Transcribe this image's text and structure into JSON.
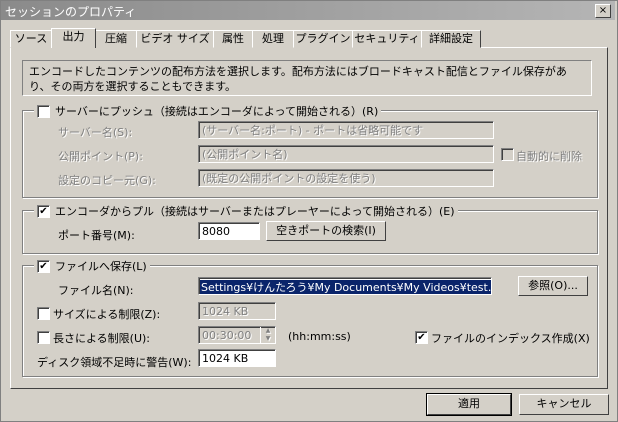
{
  "window": {
    "title": "セッションのプロパティ",
    "close": "×"
  },
  "tabs": [
    "ソース",
    "出力",
    "圧縮",
    "ビデオ サイズ",
    "属性",
    "処理",
    "プラグイン",
    "セキュリティ",
    "詳細設定"
  ],
  "description": "エンコードしたコンテンツの配布方法を選択します。配布方法にはブロードキャスト配信とファイル保存があり、その両方を選択することもできます。",
  "push": {
    "label": "サーバーにプッシュ（接続はエンコーダによって開始される）(R)",
    "checked": false,
    "server_name_label": "サーバー名(S):",
    "server_name_value": "(サーバー名:ポート) - ポートは省略可能です",
    "publish_point_label": "公開ポイント(P):",
    "publish_point_value": "(公開ポイント名)",
    "auto_delete_label": "自動的に削除",
    "copy_from_label": "設定のコピー元(G):",
    "copy_from_value": "(既定の公開ポイントの設定を使う)"
  },
  "pull": {
    "label": "エンコーダからプル（接続はサーバーまたはプレーヤーによって開始される）(E)",
    "checked": true,
    "port_label": "ポート番号(M):",
    "port_value": "8080",
    "find_port_button": "空きポートの検索(I)"
  },
  "file": {
    "label": "ファイルへ保存(L)",
    "checked": true,
    "filename_label": "ファイル名(N):",
    "filename_value": "Settings¥けんたろう¥My Documents¥My Videos¥test.wmv",
    "browse_button": "参照(O)...",
    "size_limit_label": "サイズによる制限(Z):",
    "size_limit_value": "1024 KB",
    "length_limit_label": "長さによる制限(U):",
    "length_limit_value": "00:30:00",
    "length_format": "(hh:mm:ss)",
    "index_label": "ファイルのインデックス作成(X)",
    "index_checked": true,
    "disk_warning_label": "ディスク領域不足時に警告(W):",
    "disk_warning_value": "1024 KB"
  },
  "footer": {
    "apply": "適用",
    "cancel": "キャンセル"
  },
  "colors": {
    "face": "#d4d0c8",
    "selection": "#0a246a"
  }
}
